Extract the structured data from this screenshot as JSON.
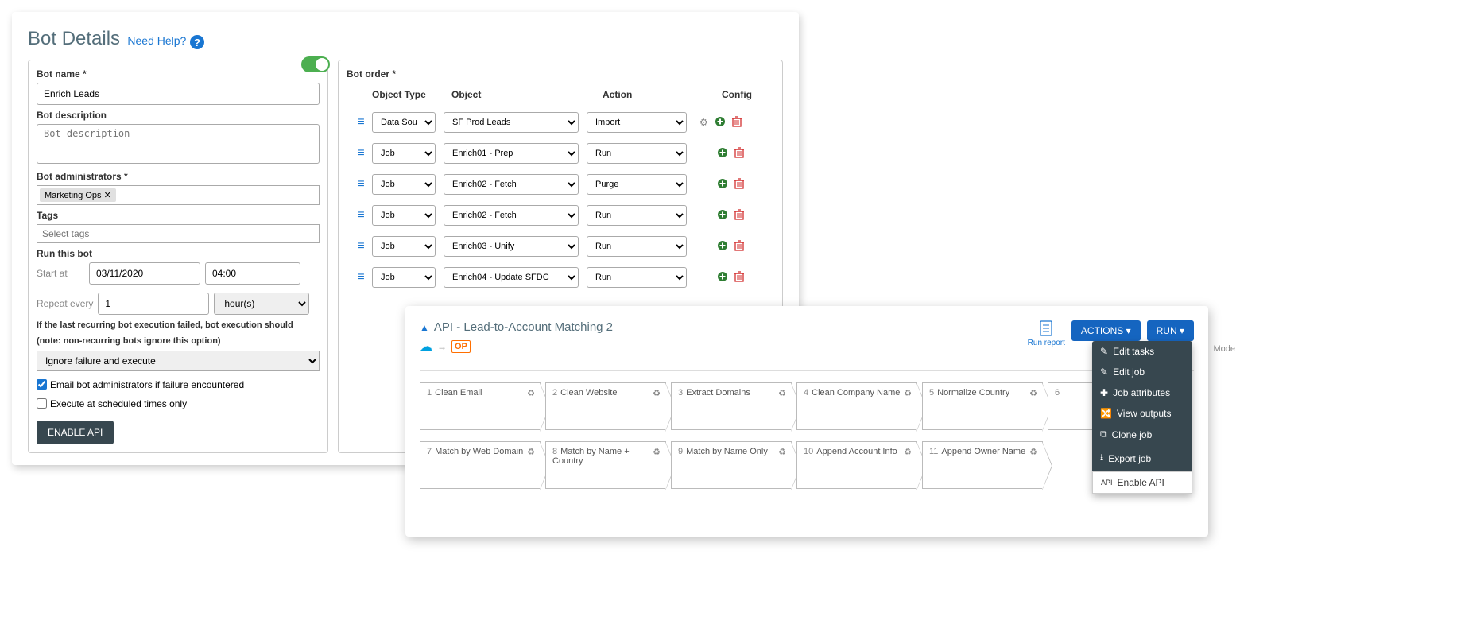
{
  "panel1": {
    "title": "Bot Details",
    "help_text": "Need Help?",
    "labels": {
      "bot_name": "Bot name *",
      "bot_description": "Bot description",
      "bot_admins": "Bot administrators *",
      "tags": "Tags",
      "run_this_bot": "Run this bot",
      "start_at": "Start at",
      "repeat_every": "Repeat every",
      "failure_note1": "If the last recurring bot execution failed, bot execution should",
      "failure_note2": "(note: non-recurring bots ignore this option)",
      "email_admins": "Email bot administrators if failure encountered",
      "scheduled_only": "Execute at scheduled times only",
      "bot_order": "Bot order *"
    },
    "values": {
      "bot_name": "Enrich Leads",
      "bot_description_placeholder": "Bot description",
      "admin_tag": "Marketing Ops ✕",
      "tags_placeholder": "Select tags",
      "start_date": "03/11/2020",
      "start_time": "04:00",
      "repeat_count": "1",
      "repeat_unit": "hour(s)",
      "failure_option": "Ignore failure and execute"
    },
    "enable_api_btn": "ENABLE API",
    "table": {
      "headers": {
        "object_type": "Object Type",
        "object": "Object",
        "action": "Action",
        "config": "Config"
      },
      "rows": [
        {
          "type": "Data Source",
          "object": "SF Prod Leads",
          "action": "Import",
          "has_gear": true
        },
        {
          "type": "Job",
          "object": "Enrich01 - Prep",
          "action": "Run",
          "has_gear": false
        },
        {
          "type": "Job",
          "object": "Enrich02 - Fetch",
          "action": "Purge",
          "has_gear": false
        },
        {
          "type": "Job",
          "object": "Enrich02 - Fetch",
          "action": "Run",
          "has_gear": false
        },
        {
          "type": "Job",
          "object": "Enrich03 - Unify",
          "action": "Run",
          "has_gear": false
        },
        {
          "type": "Job",
          "object": "Enrich04 - Update SFDC",
          "action": "Run",
          "has_gear": false
        }
      ]
    }
  },
  "panel2": {
    "title": "API - Lead-to-Account Matching 2",
    "run_report": "Run report",
    "actions_btn": "ACTIONS ",
    "run_btn": "RUN ",
    "mode_text": "Mode",
    "op_label": "OP",
    "tasks_row1": [
      {
        "n": "1",
        "name": "Clean Email"
      },
      {
        "n": "2",
        "name": "Clean Website"
      },
      {
        "n": "3",
        "name": "Extract Domains"
      },
      {
        "n": "4",
        "name": "Clean Company Name"
      },
      {
        "n": "5",
        "name": "Normalize Country"
      },
      {
        "n": "6",
        "name": ""
      }
    ],
    "tasks_row2": [
      {
        "n": "7",
        "name": "Match by Web Domain"
      },
      {
        "n": "8",
        "name": "Match by Name + Country"
      },
      {
        "n": "9",
        "name": "Match by Name Only"
      },
      {
        "n": "10",
        "name": "Append Account Info"
      },
      {
        "n": "11",
        "name": "Append Owner Name"
      }
    ],
    "menu": {
      "edit_tasks": "Edit tasks",
      "edit_job": "Edit job",
      "job_attributes": "Job attributes",
      "view_outputs": "View outputs",
      "clone_job": "Clone job",
      "export_job": "Export job",
      "enable_api": "Enable API"
    }
  }
}
